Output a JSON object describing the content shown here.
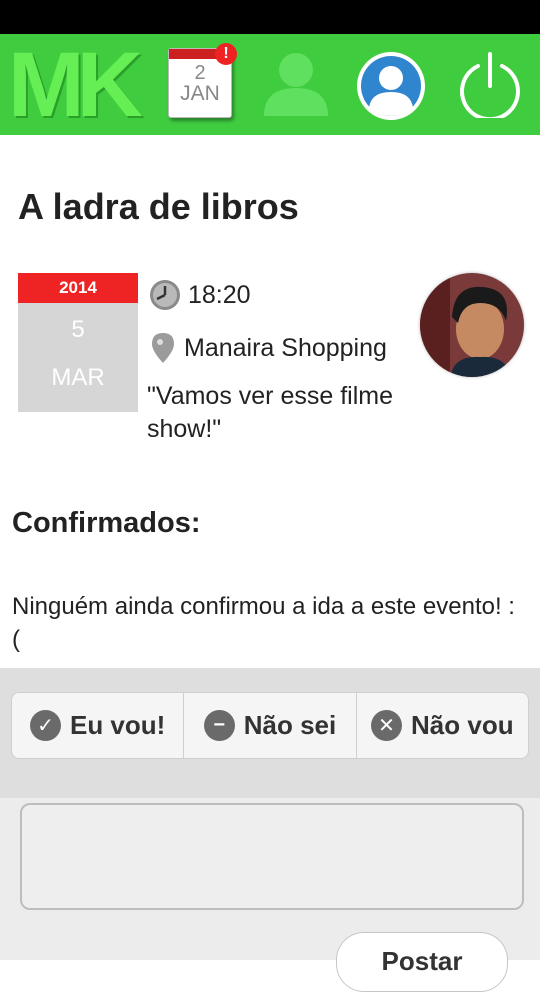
{
  "header": {
    "logo_text": "MK",
    "calendar": {
      "day": "2",
      "month": "JAN",
      "badge": "!"
    },
    "colors": {
      "bar": "#3fcc3f",
      "logo": "#66ee55"
    },
    "icons": [
      "calendar-icon",
      "person-icon",
      "avatar-icon",
      "power-icon"
    ]
  },
  "event": {
    "title": "A ladra de libros",
    "date": {
      "year": "2014",
      "day": "5",
      "month": "MAR"
    },
    "time": "18:20",
    "location": "Manaira Shopping",
    "quote": "\"Vamos ver esse filme show!\""
  },
  "confirmed": {
    "title": "Confirmados:",
    "empty_message": "Ninguém ainda confirmou a ida a este evento! :("
  },
  "rsvp": {
    "going": {
      "label": "Eu vou!",
      "icon": "check-icon"
    },
    "maybe": {
      "label": "Não sei",
      "icon": "minus-icon"
    },
    "not_going": {
      "label": "Não vou",
      "icon": "x-icon"
    }
  },
  "comment": {
    "placeholder": "",
    "post_label": "Postar"
  }
}
